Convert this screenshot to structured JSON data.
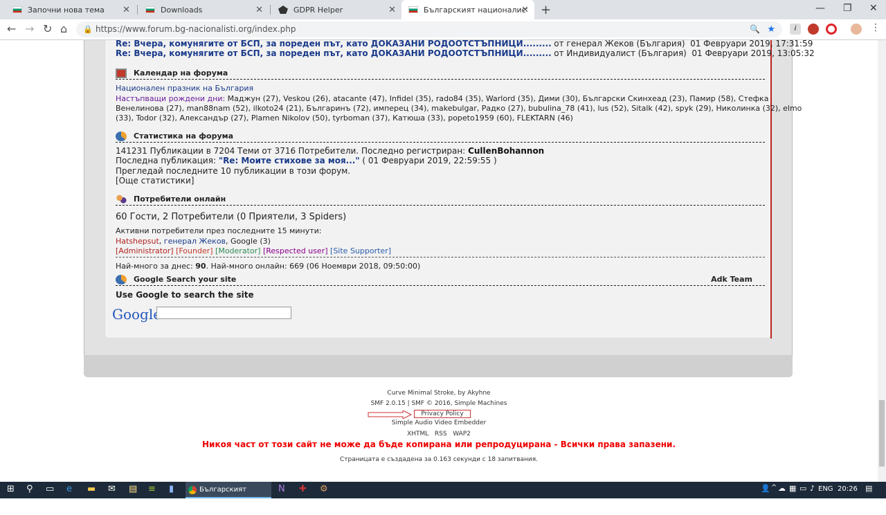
{
  "browser": {
    "tabs": [
      {
        "title": "Започни нова тема",
        "icon": "bulgarian-flag"
      },
      {
        "title": "Downloads",
        "icon": "bulgarian-flag"
      },
      {
        "title": "GDPR Helper",
        "icon": "gdpr-icon"
      },
      {
        "title": "Българският националистическ",
        "icon": "bulgarian-flag"
      }
    ],
    "url": "https://www.forum.bg-nacionalisti.org/index.php"
  },
  "recent_posts": [
    {
      "title": "Re: Вчера, комунягите от БСП, за пореден път, като ДОКАЗАНИ РОДООТСТЪПНИЦИ.........",
      "author": "от генерал Жеков (България)",
      "date": "01 Февруари 2019, 17:31:59"
    },
    {
      "title": "Re: Вчера, комунягите от БСП, за пореден път, като ДОКАЗАНИ РОДООТСТЪПНИЦИ.........",
      "author": "от Индивидуалист (България)",
      "date": "01 Февруари 2019, 13:05:32"
    }
  ],
  "calendar": {
    "heading": "Календар на форума",
    "holiday": "Национален празник на България",
    "birthdays_label": "Настъпващи рождени дни:",
    "birthdays_line1": "Маджун (27), Veskou (26), atacante (47), Infidel (35), rado84 (35), Warlord (35), Дими (30), Български Скинхеад (23), Памир (58), Стефка",
    "birthdays_line2": "Венелинова (27), man88nam (52), ilkoto24 (21), Българинъ (72), имперец (34), makebulgar, Радко (27), bubulina_78 (41), lus (52), Sitalk (42), spyk (29), Николинка (32), elmo",
    "birthdays_line3": "(33), Todor (32), Александър (27), Plamen Nikolov (50), tyrboman (37), Катюша (33), popeto1959 (60), FLEKTARN (46)"
  },
  "stats": {
    "heading": "Статистика на форума",
    "line1_prefix": "141231 Публикации в 7204 Теми от 3716 Потребители. Последно регистриран:",
    "latest_member": "CullenBohannon",
    "line2_prefix": "Последна публикация:",
    "last_post_title": "\"Re: Моите стихове за моя...\"",
    "last_post_date": "( 01 Февруари 2019, 22:59:55 )",
    "line3": "Прегледай последните 10 публикации в този форум.",
    "more": "[Още статистики]"
  },
  "online": {
    "heading": "Потребители онлайн",
    "summary": "60 Гости, 2 Потребители (0 Приятели, 3 Spiders)",
    "active_label": "Активни потребители през последните 15 минути:",
    "user1": "Hatshepsut",
    "user2": "генерал Жеков",
    "user3": "Google (3)",
    "groups": [
      "[Administrator]",
      "[Founder]",
      "[Moderator]",
      "[Respected user]",
      "[Site Supporter]"
    ],
    "most_today_prefix": "Най-много за днес:",
    "most_today_value": "90",
    "most_online": ". Най-много онлайн: 669 (06 Ноември 2018, 09:50:00)"
  },
  "google": {
    "heading": "Google Search your site",
    "team": "Adk Team",
    "subtitle": "Use Google to search the site",
    "logo": "Google"
  },
  "footer": {
    "theme": "Curve Minimal Stroke, by Akyhne",
    "smf": "SMF 2.0.15 | SMF © 2016, Simple Machines",
    "privacy": "Privacy Policy",
    "embedder": "Simple Audio Video Embedder",
    "links": [
      "XHTML",
      "RSS",
      "WAP2"
    ],
    "copyright": "Никоя част от този сайт не може да бъде копирана или репродуцирана - Всички права запазени.",
    "generated": "Страницата е създадена за 0.163 секунди с 18 запитвания."
  },
  "taskbar": {
    "app_title": "Българският национ...",
    "lang": "ENG",
    "time": "20:26"
  }
}
